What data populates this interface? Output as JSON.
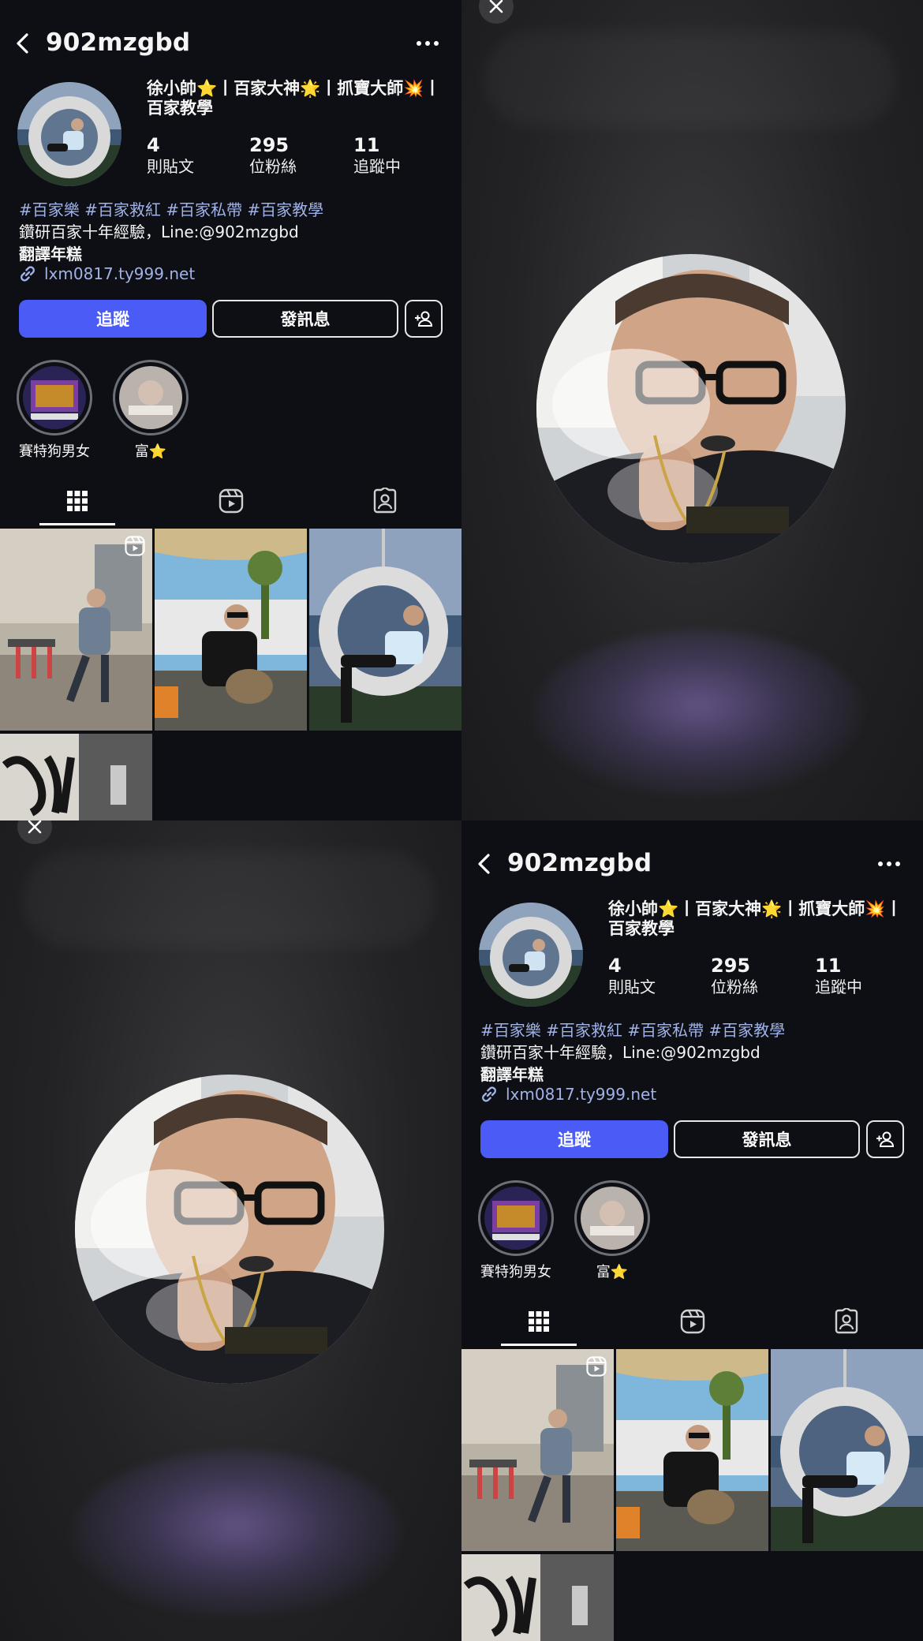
{
  "profile": {
    "username": "902mzgbd",
    "display_title": "徐小帥⭐️丨百家大神🌟丨抓寶大師💥丨百家教學",
    "stats": [
      {
        "num": "4",
        "label": "則貼文"
      },
      {
        "num": "295",
        "label": "位粉絲"
      },
      {
        "num": "11",
        "label": "追蹤中"
      }
    ],
    "hashtags": "#百家樂 #百家救紅 #百家私帶 #百家教學",
    "bio_line": "鑽研百家十年經驗，Line:@902mzgbd",
    "bio_bold": "翻譯年糕",
    "link": "lxm0817.ty999.net",
    "follow_label": "追蹤",
    "message_label": "發訊息",
    "highlights": [
      {
        "label": "賽特狗男女"
      },
      {
        "label": "富⭐️"
      }
    ],
    "tabs": [
      "posts-grid",
      "reels",
      "tagged"
    ]
  },
  "icons": {
    "back": "chevron-left-icon",
    "more": "more-horizontal-icon",
    "link": "link-icon",
    "add_user": "add-user-icon",
    "close": "close-icon",
    "reel_badge": "reel-icon"
  },
  "colors": {
    "background": "#0e0f14",
    "accent_blue": "#4a5cf5",
    "link_blue": "#9fb3e8",
    "story_bg": "#2a2a2c"
  }
}
